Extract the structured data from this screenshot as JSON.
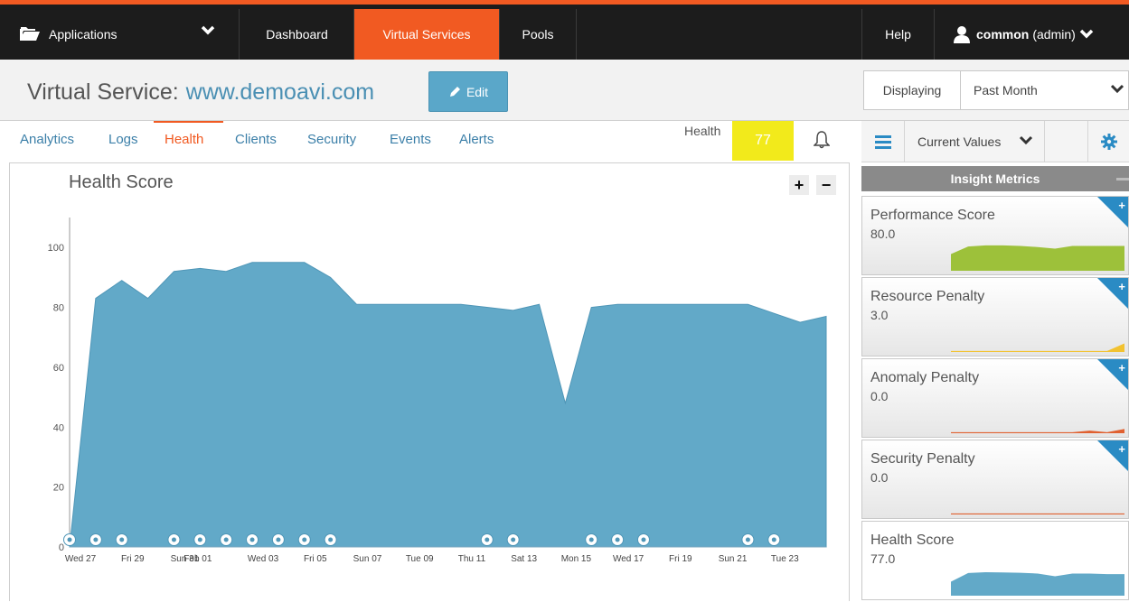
{
  "nav": {
    "applications": "Applications",
    "dashboard": "Dashboard",
    "virtual_services": "Virtual Services",
    "pools": "Pools",
    "help": "Help",
    "user_name": "common",
    "user_role": "(admin)"
  },
  "title": {
    "prefix": "Virtual Service:",
    "name": "www.demoavi.com",
    "edit_label": "Edit",
    "displaying_label": "Displaying",
    "displaying_value": "Past Month"
  },
  "tabs": [
    "Analytics",
    "Logs",
    "Health",
    "Clients",
    "Security",
    "Events",
    "Alerts"
  ],
  "active_tab": "Health",
  "health": {
    "label": "Health",
    "score": "77",
    "color": "#f2ea1b"
  },
  "chart_data": {
    "type": "area",
    "title": "Health Score",
    "color": "#62a9c8",
    "y_ticks": [
      "0",
      "20",
      "40",
      "60",
      "80",
      "100"
    ],
    "ylim": [
      0,
      110
    ],
    "x_tick_labels": [
      "Wed 27",
      "Fri 29",
      "Sun 31",
      "Feb 01",
      "Wed 03",
      "Fri 05",
      "Sun 07",
      "Tue 09",
      "Thu 11",
      "Sat 13",
      "Mon 15",
      "Wed 17",
      "Fri 19",
      "Sun 21",
      "Tue 23"
    ],
    "x": [
      0,
      1,
      2,
      3,
      4,
      5,
      6,
      7,
      8,
      9,
      10,
      11,
      12,
      13,
      14,
      15,
      16,
      17,
      18,
      19,
      20,
      21,
      22,
      23,
      24,
      25,
      26,
      27,
      28,
      29
    ],
    "values": [
      0,
      83,
      89,
      83,
      92,
      93,
      92,
      95,
      95,
      95,
      90,
      81,
      81,
      81,
      81,
      81,
      80,
      79,
      81,
      48,
      80,
      81,
      81,
      81,
      81,
      81,
      81,
      78,
      75,
      77
    ],
    "event_markers": [
      0,
      1,
      2,
      4,
      5,
      6,
      7,
      8,
      9,
      10,
      16,
      17,
      20,
      21,
      22,
      26,
      27
    ]
  },
  "right_panel": {
    "selector_value": "Current Values",
    "insight_title": "Insight Metrics",
    "metrics": [
      {
        "name": "Performance Score",
        "value": "80.0",
        "color": "#9dc13a",
        "spark": [
          60,
          88,
          92,
          92,
          90,
          86,
          80,
          90,
          90,
          90,
          90
        ]
      },
      {
        "name": "Resource Penalty",
        "value": "3.0",
        "color": "#f2c230",
        "spark": [
          2,
          2,
          2,
          2,
          2,
          2,
          2,
          2,
          2,
          2,
          30
        ]
      },
      {
        "name": "Anomaly Penalty",
        "value": "0.0",
        "color": "#e06030",
        "spark": [
          2,
          2,
          2,
          2,
          2,
          2,
          2,
          2,
          8,
          2,
          14
        ]
      },
      {
        "name": "Security Penalty",
        "value": "0.0",
        "color": "#e06030",
        "spark": [
          2,
          2,
          2,
          2,
          2,
          2,
          2,
          2,
          2,
          2,
          2
        ]
      },
      {
        "name": "Health Score",
        "value": "77.0",
        "color": "#62a9c8",
        "spark": [
          50,
          82,
          85,
          84,
          83,
          80,
          70,
          80,
          80,
          78,
          78
        ]
      }
    ]
  }
}
